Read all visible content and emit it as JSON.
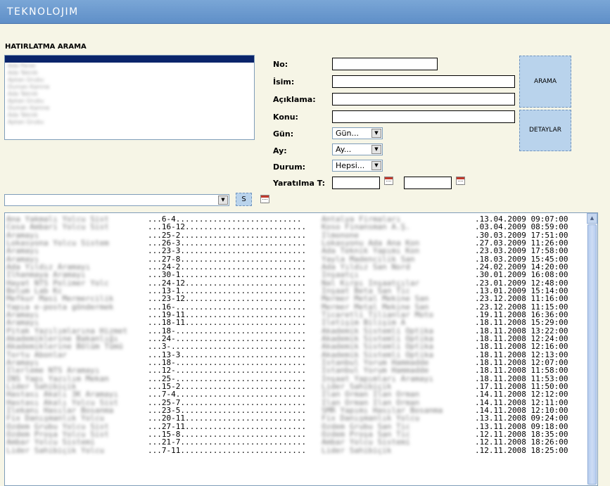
{
  "header": {
    "logo": "TEKNOLOJIM"
  },
  "search": {
    "title": "HATIRLATMA ARAMA",
    "list_items": [
      "Ada Paralı",
      "Ada Teknik",
      "Aykan Grubu",
      "Duman Kamne",
      "Ada Teknik",
      "Aykan Grubu",
      "Duman Kamne",
      "Ada Teknik",
      "Aykan Grubu"
    ],
    "labels": {
      "no": "No:",
      "isim": "İsim:",
      "aciklama": "Açıklama:",
      "konu": "Konu:",
      "gun": "Gün:",
      "ay": "Ay:",
      "durum": "Durum:",
      "yaratilma": "Yaratılma T:"
    },
    "selects": {
      "gun": "Gün...",
      "ay": "Ay...",
      "durum": "Hepsi..."
    },
    "buttons": {
      "arama": "ARAMA",
      "detaylar": "DETAYLAR",
      "s": "S"
    }
  },
  "results": [
    {
      "blur1": "Ana Yakmalı Yolcu Sist",
      "code": "...6-4...........................",
      "blur2": "Antalya Firmaları",
      "date": ".13.04.2009 09:07:00"
    },
    {
      "blur1": "Cosa Ambari Yolcu Sist",
      "code": "...16-12..........................",
      "blur2": "Koso Finansman A.Ş.",
      "date": ".03.04.2009 08:59:00"
    },
    {
      "blur1": "Aramayı",
      "code": "...25-2...........................",
      "blur2": "Ilmonone",
      "date": ".30.03.2009 17:51:00"
    },
    {
      "blur1": "Lokasyona Yolcu Sistem",
      "code": "...26-3...........................",
      "blur2": "Lokasyonu Ada Ana Kon",
      "date": ".27.03.2009 11:26:00"
    },
    {
      "blur1": "Aramayı",
      "code": "...23-3...........................",
      "blur2": "Ada Teknik Yapımı Kon",
      "date": ".23.03.2009 17:58:00"
    },
    {
      "blur1": "Aramayı",
      "code": "...27-8...........................",
      "blur2": "Yayla Madencilik San",
      "date": ".18.03.2009 15:45:00"
    },
    {
      "blur1": "Ada Yıldız Aramayı",
      "code": "...24-2...........................",
      "blur2": "Ada Yıldız San Nord",
      "date": ".24.02.2009 14:20:00"
    },
    {
      "blur1": "İlhanmaya Aramayı",
      "code": "...30-1...........................",
      "blur2": "İnşaatçı",
      "date": ".30.01.2009 16:08:00"
    },
    {
      "blur1": "Hayat NTS Polimer Yolc",
      "code": "...24-12..........................",
      "blur2": "Nal Kırpı İnşaatçılar",
      "date": ".23.01.2009 12:48:00"
    },
    {
      "blur1": "Bolum Lab Kc",
      "code": "...13-1...........................",
      "blur2": "İnşaat Beta San Tic",
      "date": ".13.01.2009 15:14:00"
    },
    {
      "blur1": "Mefkur Masi Mermercilik",
      "code": "...23-12..........................",
      "blur2": "Mermer Metal Mekine San",
      "date": ".23.12.2008 11:16:00"
    },
    {
      "blur1": "Yapıa e-posta göndermek",
      "code": "...16-............................",
      "blur2": "Mermer Metal Mekine San",
      "date": ".23.12.2008 11:15:00"
    },
    {
      "blur1": "Aramayı",
      "code": "...19-11..........................",
      "blur2": "Ticaretli Tilianlar Moto",
      "date": ".19.11.2008 16:36:00"
    },
    {
      "blur1": "Aramayı",
      "code": "...18-11..........................",
      "blur2": "Iletişim Bilişim A",
      "date": ".18.11.2008 15:29:00"
    },
    {
      "blur1": "Pitak Yazılımlarına Hizmet",
      "code": "...18-............................",
      "blur2": "Akademik Sistemli Optika",
      "date": ".18.11.2008 13:22:00"
    },
    {
      "blur1": "Akademiklerine Bakanlığı",
      "code": "...24-............................",
      "blur2": "Akademik Sistemli Optika",
      "date": ".18.11.2008 12:24:00"
    },
    {
      "blur1": "Akademiklerine Bölüm Tümü",
      "code": "...3-.............................",
      "blur2": "Akademik Sistemli Optika",
      "date": ".18.11.2008 12:16:00"
    },
    {
      "blur1": "Tortu Abonlar",
      "code": "...13-3...........................",
      "blur2": "Akademik Sistemli Optika",
      "date": ".18.11.2008 12:13:00"
    },
    {
      "blur1": "Aramayı",
      "code": "...18-............................",
      "blur2": "İstanbul Yorum Hammadde",
      "date": ".18.11.2008 12:07:00"
    },
    {
      "blur1": "Ilerleme NTS Aramayı",
      "code": "...12-............................",
      "blur2": "İstanbul Yorum Hammadde",
      "date": ".18.11.2008 11:58:00"
    },
    {
      "blur1": "İNS Yapı Yazılım Mekan",
      "code": "...25-............................",
      "blur2": "İnşaat Yapımları Aramayı",
      "date": ".18.11.2008 11:53:00"
    },
    {
      "blur1": "Lider Sahibiçik",
      "code": "...15-2...........................",
      "blur2": "Lider Sahibiçik",
      "date": ".17.11.2008 11:50:00"
    },
    {
      "blur1": "Hastası Akalı 3K Aramayı",
      "code": "...7-4............................",
      "blur2": "Ilan Orman Ilan Orman",
      "date": ".14.11.2008 12:12:00"
    },
    {
      "blur1": "Hastası Akalı Yolcu Sist",
      "code": "...25-7...........................",
      "blur2": "Ilan Orman Ilan Orman",
      "date": ".14.11.2008 12:11:00"
    },
    {
      "blur1": "Ilekanı Hasılar Bosanma",
      "code": "...23-5...........................",
      "blur2": "SMR Yapımı Hasılar Bosanma",
      "date": ".14.11.2008 12:10:00"
    },
    {
      "blur1": "Fix Danışmanlık Yolcu",
      "code": "...20-11..........................",
      "blur2": "Fix Danışmanlık Yolcu",
      "date": ".13.11.2008 09:24:00"
    },
    {
      "blur1": "Özdem Grubu Yolcu Sist",
      "code": "...27-11..........................",
      "blur2": "Özdem Grubu San Tic",
      "date": ".13.11.2008 09:18:00"
    },
    {
      "blur1": "Özdem Proşa Yolcu Sist",
      "code": "...15-8...........................",
      "blur2": "Özdem Proşa San Tic",
      "date": ".12.11.2008 18:35:00"
    },
    {
      "blur1": "Ambar Yolcu Sistemi",
      "code": "...21-7...........................",
      "blur2": "Ambar Yolcu Sistemi",
      "date": ".12.11.2008 18:26:00"
    },
    {
      "blur1": "Lider Sahibiçik Yolcu",
      "code": "...7-11...........................",
      "blur2": "Lider Sahibiçik",
      "date": ".12.11.2008 18:25:00"
    }
  ]
}
